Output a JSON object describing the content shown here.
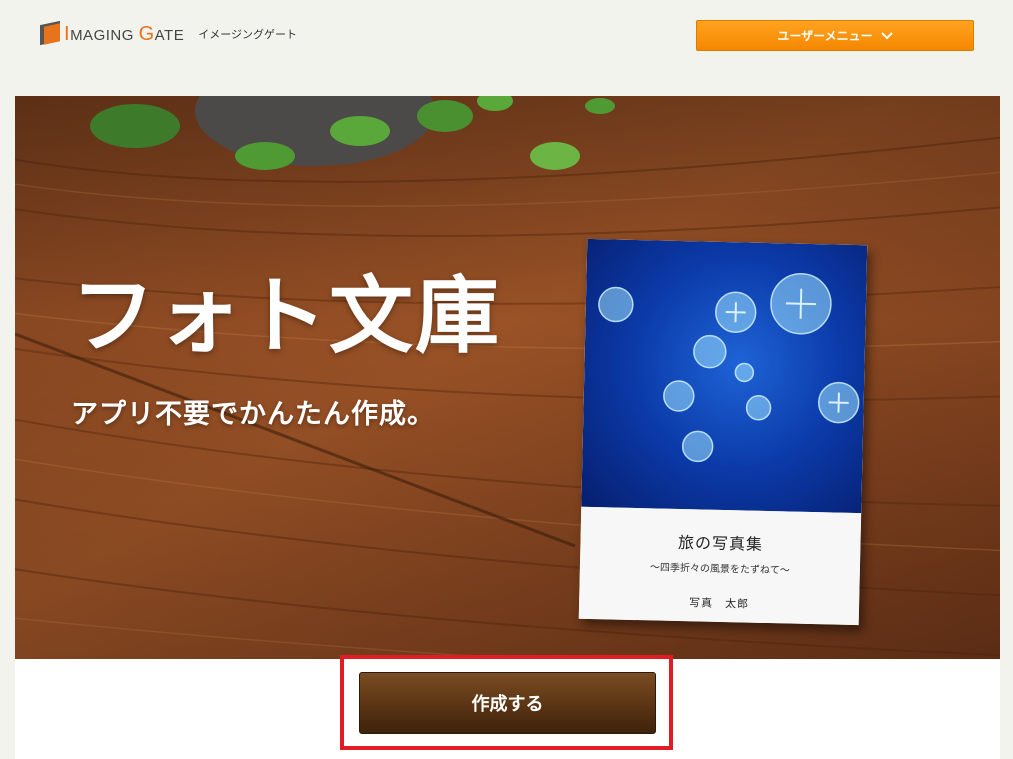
{
  "header": {
    "logo_mark_icon": "imaging-gate-logo-icon",
    "logo_text_I": "I",
    "logo_text_maging": "MAGING ",
    "logo_text_G": "G",
    "logo_text_ate": "ATE",
    "logo_subtitle": "イメージングゲート",
    "user_menu_label": "ユーザーメニュー",
    "user_menu_icon": "chevron-down-icon"
  },
  "hero": {
    "title": "フォト文庫",
    "subtitle": "アプリ不要でかんたん作成。",
    "book": {
      "title": "旅の写真集",
      "subtitle": "〜四季折々の風景をたずねて〜",
      "author": "写真　太郎"
    }
  },
  "actions": {
    "create_label": "作成する"
  },
  "colors": {
    "accent_orange": "#f58700",
    "button_brown": "#5a3414",
    "highlight_red": "#e01d25"
  }
}
